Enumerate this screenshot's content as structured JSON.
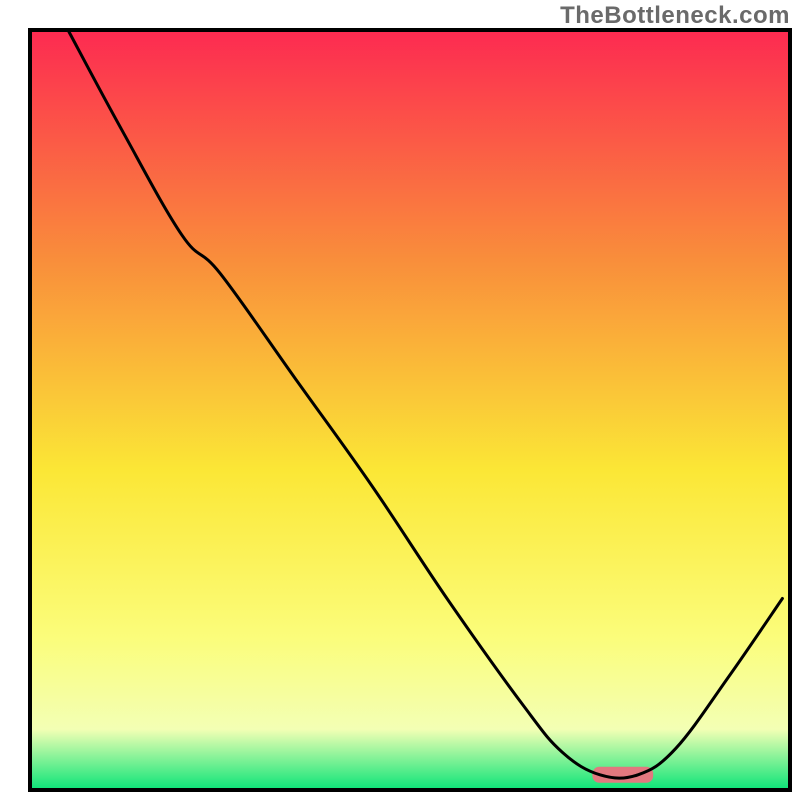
{
  "watermark": "TheBottleneck.com",
  "chart_data": {
    "type": "line",
    "title": "",
    "xlabel": "",
    "ylabel": "",
    "xlim": [
      0,
      100
    ],
    "ylim": [
      0,
      100
    ],
    "axes_visible": false,
    "background_gradient": {
      "top": "#fd2a51",
      "mid_upper": "#f98d3b",
      "mid": "#fbe736",
      "mid_lower": "#fbfd7b",
      "bottom": "#0ae478"
    },
    "curve": [
      {
        "x": 5,
        "y": 100.0
      },
      {
        "x": 12,
        "y": 87.0
      },
      {
        "x": 20,
        "y": 73.0
      },
      {
        "x": 25,
        "y": 68.0
      },
      {
        "x": 35,
        "y": 54.0
      },
      {
        "x": 45,
        "y": 40.0
      },
      {
        "x": 55,
        "y": 25.0
      },
      {
        "x": 65,
        "y": 11.0
      },
      {
        "x": 70,
        "y": 5.0
      },
      {
        "x": 75,
        "y": 2.0
      },
      {
        "x": 80,
        "y": 2.0
      },
      {
        "x": 85,
        "y": 5.5
      },
      {
        "x": 92,
        "y": 15.0
      },
      {
        "x": 99,
        "y": 25.2
      }
    ],
    "highlight_rect": {
      "x0": 74,
      "x1": 82,
      "y": 2.0,
      "fill": "#e2787f"
    },
    "border": "#000000",
    "curve_stroke": "#000000",
    "curve_stroke_width": 3
  }
}
